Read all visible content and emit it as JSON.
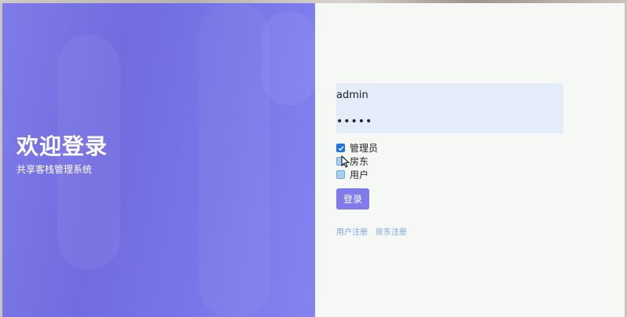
{
  "hero": {
    "title": "欢迎登录",
    "subtitle": "共享客栈管理系统"
  },
  "form": {
    "username": "admin",
    "password": "•••••",
    "roles": [
      {
        "label": "管理员",
        "checked": true
      },
      {
        "label": "房东",
        "checked": false
      },
      {
        "label": "用户",
        "checked": false
      }
    ],
    "login_label": "登录",
    "links": {
      "user_register": "用户注册",
      "landlord_register": "房东注册"
    }
  },
  "colors": {
    "accent": "#7f7be8",
    "link": "#7aa6dc",
    "input_bg": "#e3ecf8",
    "checkbox_checked": "#1a73e8"
  }
}
